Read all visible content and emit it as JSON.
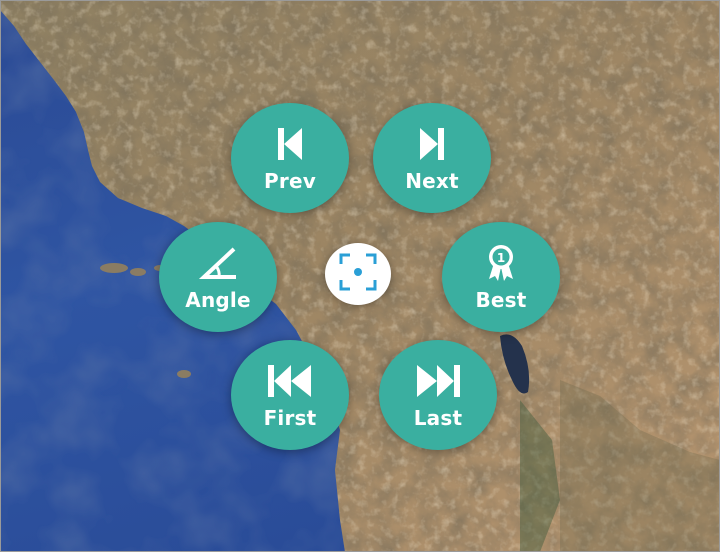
{
  "colors": {
    "button_fill": "#3aafa0",
    "button_text": "#ffffff",
    "center_fill": "#ffffff",
    "center_icon": "#2a9fd6",
    "ocean": "#2c4f9a",
    "land": "#a88e68"
  },
  "map": {
    "type": "satellite-imagery"
  },
  "menu": {
    "prev": {
      "label": "Prev",
      "icon": "skip-previous-icon"
    },
    "next": {
      "label": "Next",
      "icon": "skip-next-icon"
    },
    "angle": {
      "label": "Angle",
      "icon": "angle-icon"
    },
    "best": {
      "label": "Best",
      "icon": "award-ribbon-icon"
    },
    "first": {
      "label": "First",
      "icon": "skip-to-first-icon"
    },
    "last": {
      "label": "Last",
      "icon": "skip-to-last-icon"
    },
    "center": {
      "icon": "focus-target-icon"
    }
  }
}
